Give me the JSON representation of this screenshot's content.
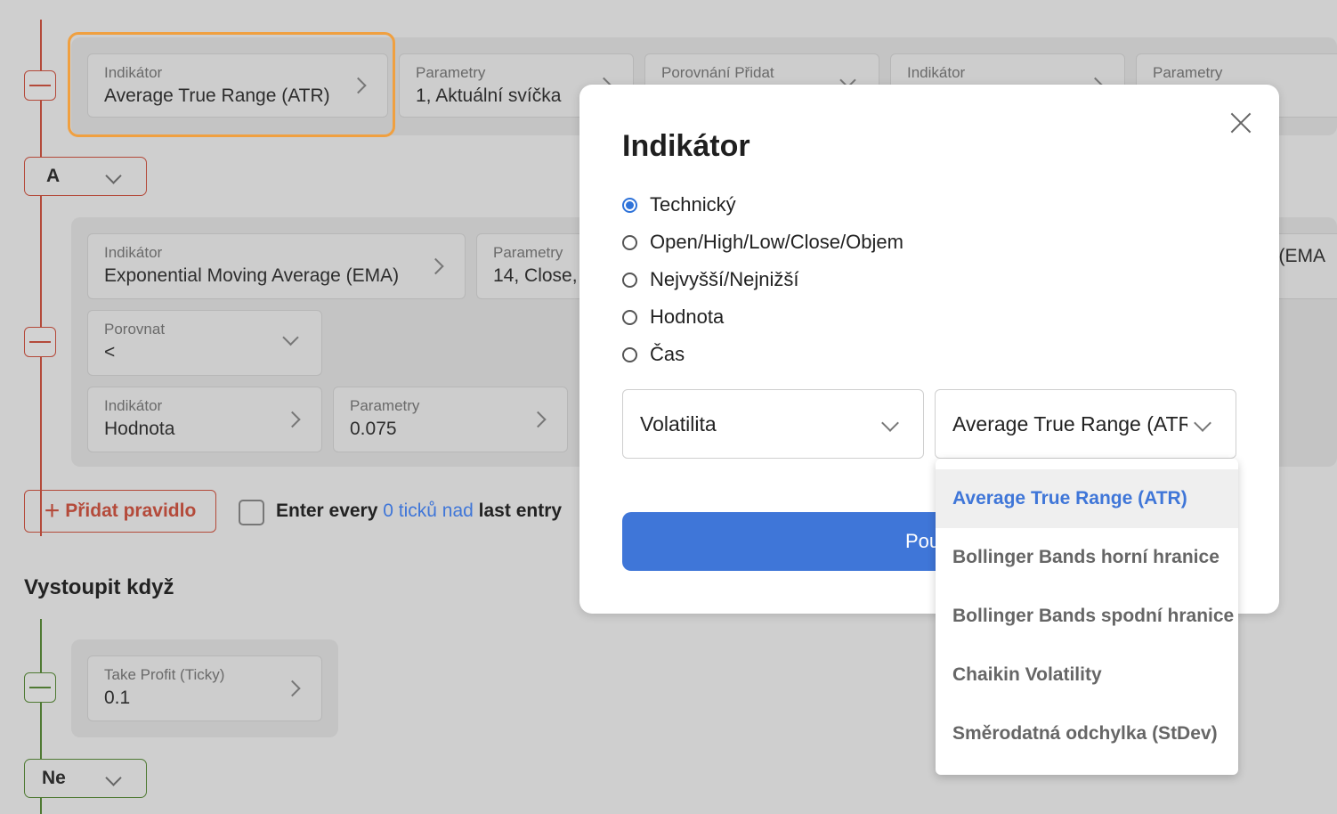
{
  "entry": {
    "group1": {
      "cards": [
        {
          "label": "Indikátor",
          "value": "Average True Range (ATR)",
          "chevron": "right"
        },
        {
          "label": "Parametry",
          "value": "1, Aktuální svíčka",
          "chevron": "right"
        },
        {
          "label": "Porovnání Přidat",
          "value": "",
          "chevron": "down"
        },
        {
          "label": "Indikátor",
          "value": "",
          "chevron": "right"
        },
        {
          "label": "Parametry",
          "value": "",
          "chevron": "right"
        }
      ]
    },
    "logic_select": "A",
    "group2": {
      "cards": [
        {
          "label": "Indikátor",
          "value": "Exponential Moving Average (EMA)"
        },
        {
          "label": "Parametry",
          "value": "14, Close,"
        },
        {
          "label": "",
          "value": "e (EMA"
        },
        {
          "label": "Porovnat",
          "value": "<"
        },
        {
          "label": "Indikátor",
          "value": "Hodnota"
        },
        {
          "label": "Parametry",
          "value": "0.075"
        }
      ]
    },
    "add_rule_label": "Přidat pravidlo",
    "enter_every": {
      "pre": "Enter every",
      "link": "0 ticků nad",
      "post": "last entry"
    }
  },
  "exit": {
    "title": "Vystoupit když",
    "card": {
      "label": "Take Profit (Ticky)",
      "value": "0.1"
    },
    "logic_select": "Ne"
  },
  "modal": {
    "title": "Indikátor",
    "radios": [
      {
        "label": "Technický",
        "selected": true
      },
      {
        "label": "Open/High/Low/Close/Objem",
        "selected": false
      },
      {
        "label": "Nejvyšší/Nejnižší",
        "selected": false
      },
      {
        "label": "Hodnota",
        "selected": false
      },
      {
        "label": "Čas",
        "selected": false
      }
    ],
    "category_select": "Volatilita",
    "indicator_select": "Average True Range (ATR)",
    "apply_label": "Použít",
    "dropdown_options": [
      {
        "label": "Average True Range (ATR)",
        "active": true
      },
      {
        "label": "Bollinger Bands horní hranice",
        "active": false
      },
      {
        "label": "Bollinger Bands spodní hranice",
        "active": false
      },
      {
        "label": "Chaikin Volatility",
        "active": false
      },
      {
        "label": "Směrodatná odchylka (StDev)",
        "active": false
      }
    ]
  },
  "colors": {
    "accent_blue": "#3f76d8",
    "entry_red": "#b44a3a",
    "exit_green": "#4f7a33",
    "highlight_orange": "#f0a040"
  }
}
